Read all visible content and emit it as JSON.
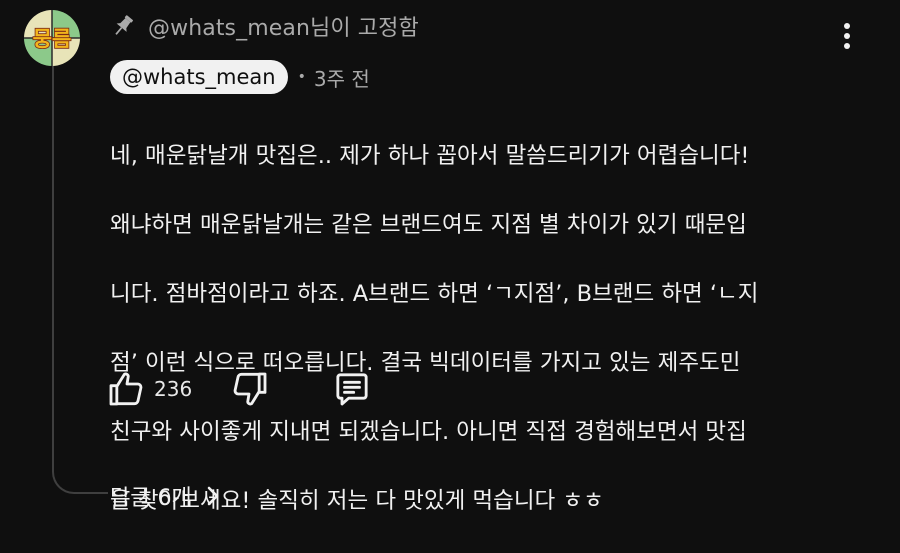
{
  "pinned": {
    "text": "@whats_mean님이 고정함",
    "icon": "pin-icon"
  },
  "avatar": {
    "text": "뭉름",
    "colors": {
      "top_left": "#e8e4b8",
      "top_right": "#8cc98a",
      "bottom_left": "#8cc98a",
      "bottom_right": "#e8e4b8",
      "text_fill": "#f2b51c",
      "text_stroke": "#7a2a16"
    }
  },
  "comment": {
    "author": "@whats_mean",
    "separator": "•",
    "time": "3주 전",
    "lines": [
      "네, 매운닭날개 맛집은.. 제가 하나 꼽아서 말씀드리기가 어렵습니다!",
      "왜냐하면 매운닭날개는 같은 브랜드여도 지점 별 차이가 있기 때문입",
      "니다. 점바점이라고 하죠. A브랜드 하면 ‘ㄱ지점’, B브랜드 하면 ‘ㄴ지",
      "점’ 이런 식으로 떠오릅니다. 결국 빅데이터를 가지고 있는 제주도민",
      "친구와 사이좋게 지내면 되겠습니다. 아니면 직접 경험해보면서 맛집",
      "을 찾아보세요! 솔직히 저는 다 맛있게 먹습니다 ㅎㅎ"
    ]
  },
  "actions": {
    "like_icon": "thumbs-up-icon",
    "like_count": "236",
    "dislike_icon": "thumbs-down-icon",
    "reply_icon": "reply-comment-icon"
  },
  "replies": {
    "label": "답글 6개",
    "icon": "chevron-right-icon"
  },
  "menu": {
    "icon": "more-vertical-icon"
  },
  "colors": {
    "background": "#0f0f0f",
    "text_primary": "#f1f1f1",
    "text_secondary": "#aaaaaa",
    "chip_background": "#f1f1f1",
    "thread_line": "#3f3f3f"
  }
}
